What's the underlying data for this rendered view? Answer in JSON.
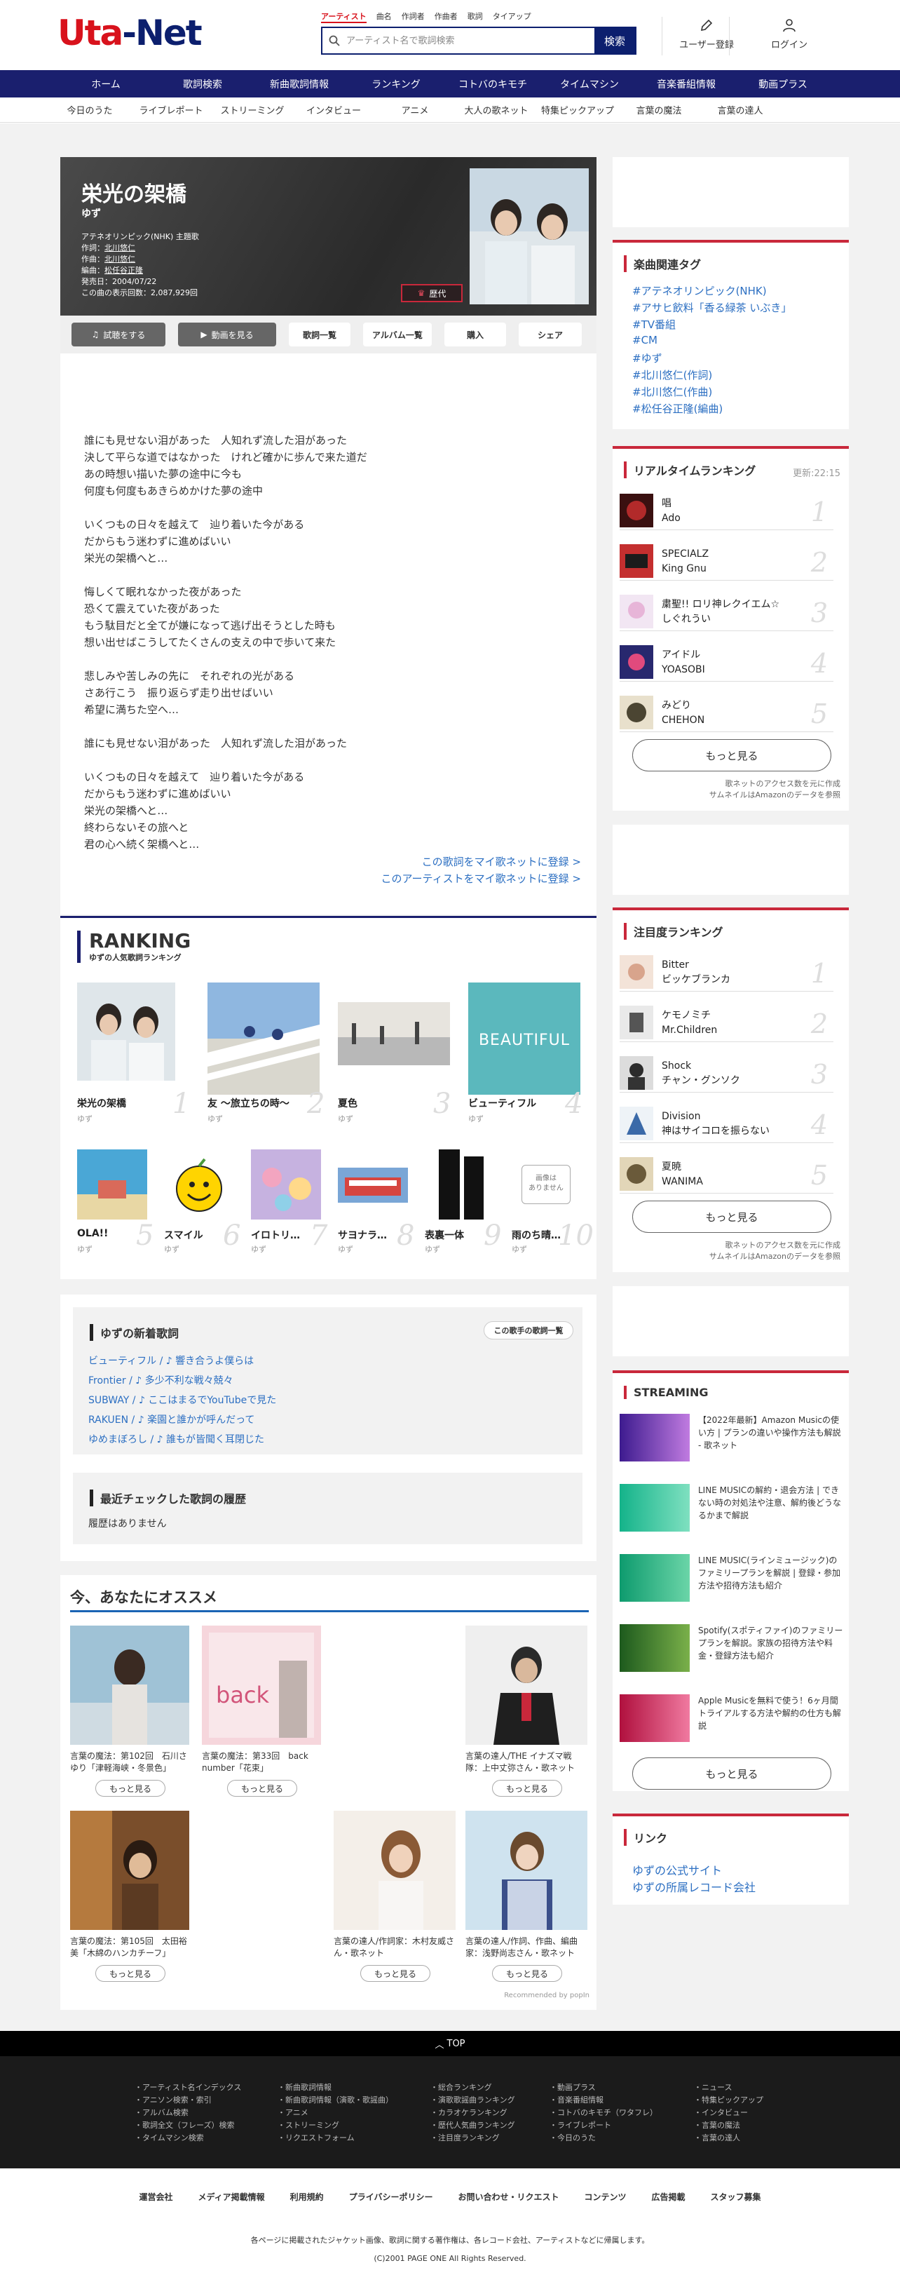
{
  "header": {
    "logo_u": "Uta",
    "logo_rest": "-Net",
    "search_tabs": [
      "アーティスト",
      "曲名",
      "作詞者",
      "作曲者",
      "歌詞",
      "タイアップ"
    ],
    "search_placeholder": "アーティスト名で歌詞検索",
    "search_button": "検索",
    "register": "ユーザー登録",
    "login": "ログイン"
  },
  "nav": [
    "ホーム",
    "歌詞検索",
    "新曲歌詞情報",
    "ランキング",
    "コトバのキモチ",
    "タイムマシン",
    "音楽番組情報",
    "動画プラス"
  ],
  "subnav": [
    "今日のうた",
    "ライブレポート",
    "ストリーミング",
    "インタビュー",
    "アニメ",
    "大人の歌ネット",
    "特集ピックアップ",
    "言葉の魔法",
    "言葉の達人"
  ],
  "song": {
    "title": "栄光の架橋",
    "artist": "ゆず",
    "tieup": "アテネオリンピック(NHK) 主題歌",
    "lyricist_label": "作詞：",
    "lyricist": "北川悠仁",
    "composer_label": "作曲：",
    "composer": "北川悠仁",
    "arranger_label": "編曲：",
    "arranger": "松任谷正隆",
    "release": "発売日：2004/07/22",
    "views": "この曲の表示回数：2,087,929回",
    "badge": "歴代",
    "buttons": [
      "試聴をする",
      "動画を見る",
      "歌詞一覧",
      "アルバム一覧",
      "購入",
      "シェア"
    ],
    "lyrics": "誰にも見せない泪があった　人知れず流した泪があった\n決して平らな道ではなかった　けれど確かに歩んで来た道だ\nあの時想い描いた夢の途中に今も\n何度も何度もあきらめかけた夢の途中\n\nいくつもの日々を越えて　辿り着いた今がある\nだからもう迷わずに進めばいい\n栄光の架橋へと…\n\n悔しくて眠れなかった夜があった\n恐くて震えていた夜があった\nもう駄目だと全てが嫌になって逃げ出そうとした時も\n想い出せばこうしてたくさんの支えの中で歩いて来た\n\n悲しみや苦しみの先に　それぞれの光がある\nさあ行こう　振り返らず走り出せばいい\n希望に満ちた空へ…\n\n誰にも見せない泪があった　人知れず流した泪があった\n\nいくつもの日々を越えて　辿り着いた今がある\nだからもう迷わずに進めばいい\n栄光の架橋へと…\n終わらないその旅へと\n君の心へ続く架橋へと…",
    "mylink1": "この歌詞をマイ歌ネットに登録 >",
    "mylink2": "このアーティストをマイ歌ネットに登録 >"
  },
  "ranking": {
    "title": "RANKING",
    "sub": "ゆずの人気歌詞ランキング",
    "items": [
      {
        "t": "栄光の架橋",
        "a": "ゆず",
        "n": "1"
      },
      {
        "t": "友 ～旅立ちの時～",
        "a": "ゆず",
        "n": "2"
      },
      {
        "t": "夏色",
        "a": "ゆず",
        "n": "3"
      },
      {
        "t": "ビューティフル",
        "a": "ゆず",
        "n": "4"
      },
      {
        "t": "OLA!!",
        "a": "ゆず",
        "n": "5"
      },
      {
        "t": "スマイル",
        "a": "ゆず",
        "n": "6"
      },
      {
        "t": "イロトリ…",
        "a": "ゆず",
        "n": "7"
      },
      {
        "t": "サヨナラ…",
        "a": "ゆず",
        "n": "8"
      },
      {
        "t": "表裏一体",
        "a": "ゆず",
        "n": "9"
      },
      {
        "t": "雨のち晴…",
        "a": "ゆず",
        "n": "10"
      }
    ],
    "beautiful": "BEAUTIFUL",
    "noimage": "画像は\nありません"
  },
  "newsongs": {
    "title": "ゆずの新着歌詞",
    "more": "この歌手の歌詞一覧",
    "items": [
      "ビューティフル / ♪ 響き合うよ僕らは",
      "Frontier / ♪ 多少不利な戦々兢々",
      "SUBWAY / ♪ ここはまるでYouTubeで見た",
      "RAKUEN / ♪ 楽園と誰かが呼んだって",
      "ゆめまぼろし / ♪ 誰もが皆聞く耳閉じた"
    ]
  },
  "history": {
    "title": "最近チェックした歌詞の履歴",
    "empty": "履歴はありません"
  },
  "recommend": {
    "title": "今、あなたにオススメ",
    "more": "もっと見る",
    "powered": "Recommended by popIn",
    "items": [
      "言葉の魔法：第102回　石川さゆり「津軽海峡・冬景色」",
      "言葉の魔法：第33回　back number「花束」",
      "言葉の達人/THE イナズマ戦隊：上中丈弥さん・歌ネット",
      "言葉の魔法：第105回　太田裕美「木綿のハンカチーフ」",
      "言葉の達人/作詞家：木村友威さん・歌ネット",
      "言葉の達人/作詞、作曲、編曲家：浅野尚志さん・歌ネット"
    ]
  },
  "sidebar": {
    "tags_title": "楽曲関連タグ",
    "tags": [
      "#アテネオリンピック(NHK)",
      "#アサヒ飲料「香る緑茶 いぶき」",
      "#TV番組",
      "#CM",
      "#ゆず",
      "#北川悠仁(作詞)",
      "#北川悠仁(作曲)",
      "#松任谷正隆(編曲)"
    ],
    "realtime_title": "リアルタイムランキング",
    "realtime_updated": "更新:22:15",
    "realtime": [
      {
        "s": "唱",
        "a": "Ado",
        "n": "1"
      },
      {
        "s": "SPECIALZ",
        "a": "King Gnu",
        "n": "2"
      },
      {
        "s": "粛聖!! ロリ神レクイエム☆",
        "a": "しぐれうい",
        "n": "3"
      },
      {
        "s": "アイドル",
        "a": "YOASOBI",
        "n": "4"
      },
      {
        "s": "みどり",
        "a": "CHEHON",
        "n": "5"
      }
    ],
    "more": "もっと見る",
    "note1": "歌ネットのアクセス数を元に作成",
    "note2": "サムネイルはAmazonのデータを参照",
    "attention_title": "注目度ランキング",
    "attention": [
      {
        "s": "Bitter",
        "a": "ビッケブランカ",
        "n": "1"
      },
      {
        "s": "ケモノミチ",
        "a": "Mr.Children",
        "n": "2"
      },
      {
        "s": "Shock",
        "a": "チャン・グンソク",
        "n": "3"
      },
      {
        "s": "Division",
        "a": "神はサイコロを振らない",
        "n": "4"
      },
      {
        "s": "夏暁",
        "a": "WANIMA",
        "n": "5"
      }
    ],
    "streaming_title": "STREAMING",
    "streaming": [
      "【2022年最新】Amazon Musicの使い方 | プランの違いや操作方法も解説 - 歌ネット",
      "LINE MUSICの解約・退会方法 | できない時の対処法や注意、解約後どうなるかまで解説",
      "LINE MUSIC(ラインミュージック)のファミリープランを解説 | 登録・参加方法や招待方法も紹介",
      "Spotify(スポティファイ)のファミリープランを解説。家族の招待方法や料金・登録方法も紹介",
      "Apple Musicを無料で使う！6ヶ月間トライアルする方法や解約の仕方も解説"
    ],
    "link_title": "リンク",
    "links": [
      "ゆずの公式サイト",
      "ゆずの所属レコード会社"
    ]
  },
  "footer": {
    "top": "TOP",
    "col1": [
      "・アーティスト名インデックス",
      "・アニソン検索・索引",
      "・アルバム検索",
      "・歌詞全文（フレーズ）検索",
      "・タイムマシン検索"
    ],
    "col2": [
      "・新曲歌詞情報",
      "・新曲歌詞情報（演歌・歌謡曲）",
      "・アニメ",
      "・ストリーミング",
      "・リクエストフォーム"
    ],
    "col3": [
      "・総合ランキング",
      "・演歌歌謡曲ランキング",
      "・カラオケランキング",
      "・歴代人気曲ランキング",
      "・注目度ランキング"
    ],
    "col4": [
      "・動画プラス",
      "・音楽番組情報",
      "・コトバのキモチ（ワタフレ）",
      "・ライブレポート",
      "・今日のうた"
    ],
    "col5": [
      "・ニュース",
      "・特集ピックアップ",
      "・インタビュー",
      "・言葉の魔法",
      "・言葉の達人"
    ],
    "links": [
      "運営会社",
      "メディア掲載情報",
      "利用規約",
      "プライバシーポリシー",
      "お問い合わせ・リクエスト",
      "コンテンツ",
      "広告掲載",
      "スタッフ募集"
    ],
    "note": "各ページに掲載されたジャケット画像、歌詞に関する著作権は、各レコード会社、アーティストなどに帰属します。",
    "copy": "(C)2001 PAGE ONE All Rights Reserved."
  },
  "colors": {
    "navy": "#1a1f6e",
    "red": "#d8121c",
    "link": "#2c6fc2"
  }
}
